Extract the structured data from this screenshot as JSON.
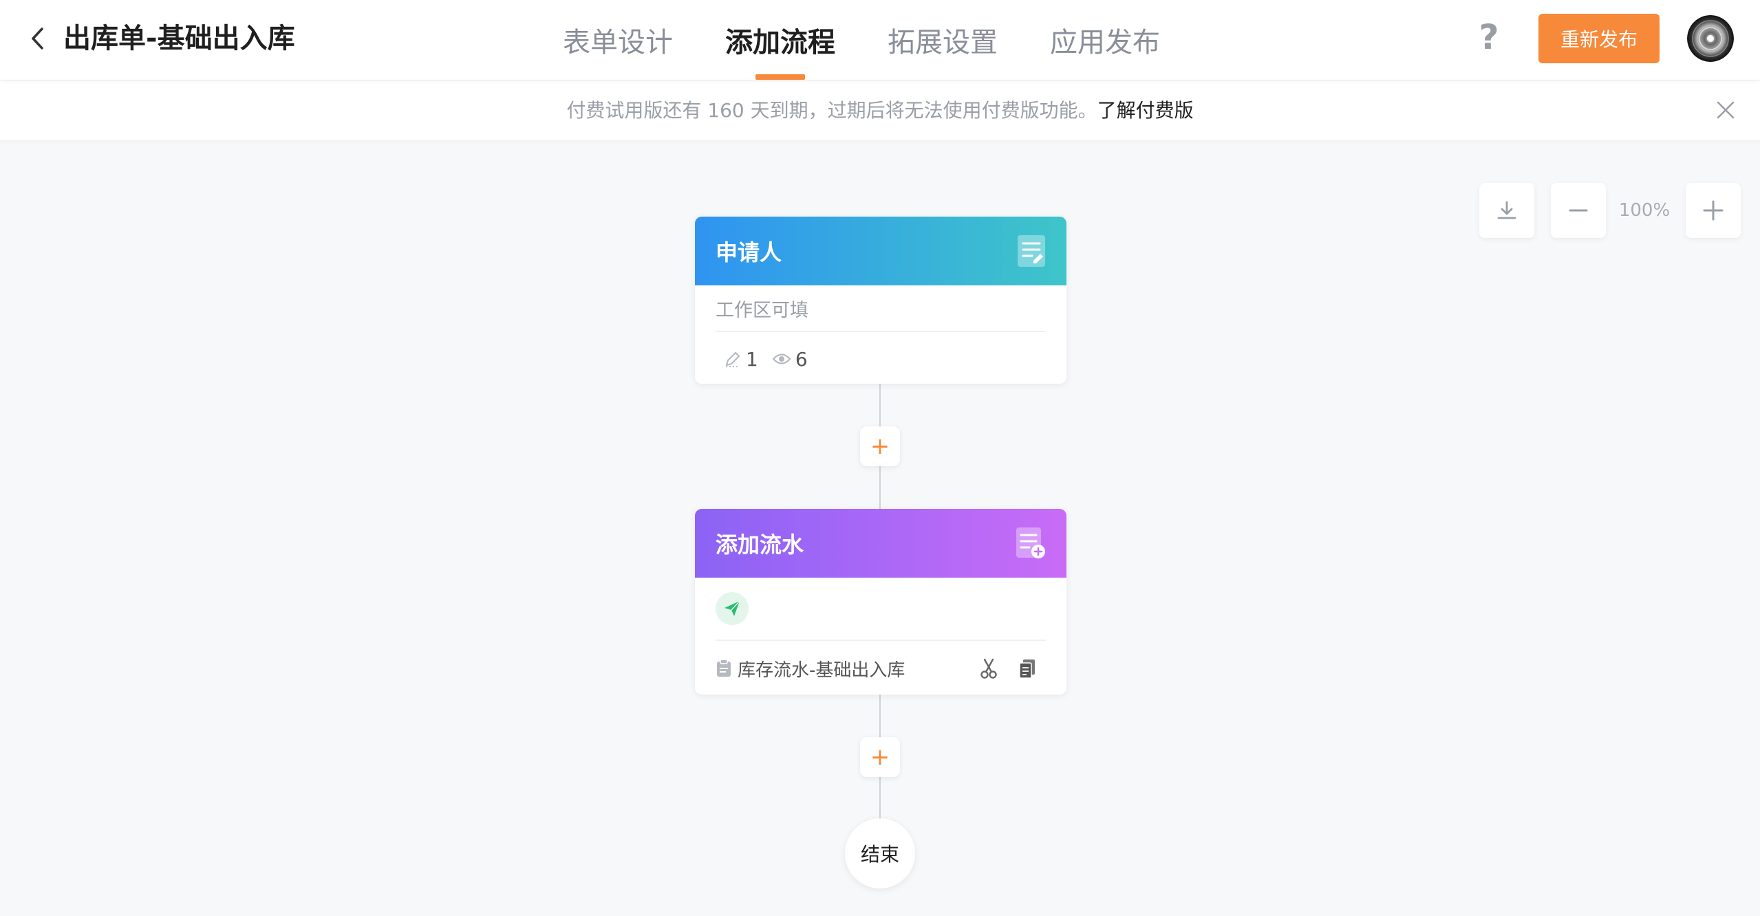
{
  "header": {
    "title": "出库单-基础出入库",
    "tabs": [
      {
        "label": "表单设计",
        "active": false
      },
      {
        "label": "添加流程",
        "active": true
      },
      {
        "label": "拓展设置",
        "active": false
      },
      {
        "label": "应用发布",
        "active": false
      }
    ],
    "help_label": "?",
    "republish_label": "重新发布"
  },
  "notice": {
    "text": "付费试用版还有 160 天到期，过期后将无法使用付费版功能。",
    "link_label": "了解付费版"
  },
  "zoom": {
    "level": "100%"
  },
  "flow": {
    "applicant": {
      "title": "申请人",
      "field_line": "工作区可填",
      "edit_count": "1",
      "view_count": "6"
    },
    "add_record": {
      "title": "添加流水",
      "target": "库存流水-基础出入库"
    },
    "plus_label": "+",
    "end_label": "结束"
  },
  "colors": {
    "accent": "#f6893a",
    "applicant_gradient": [
      "#2f94f1",
      "#3ec5c9"
    ],
    "add_record_gradient": [
      "#8b63f5",
      "#c86cf7"
    ],
    "action_green": "#2bbd6f"
  }
}
